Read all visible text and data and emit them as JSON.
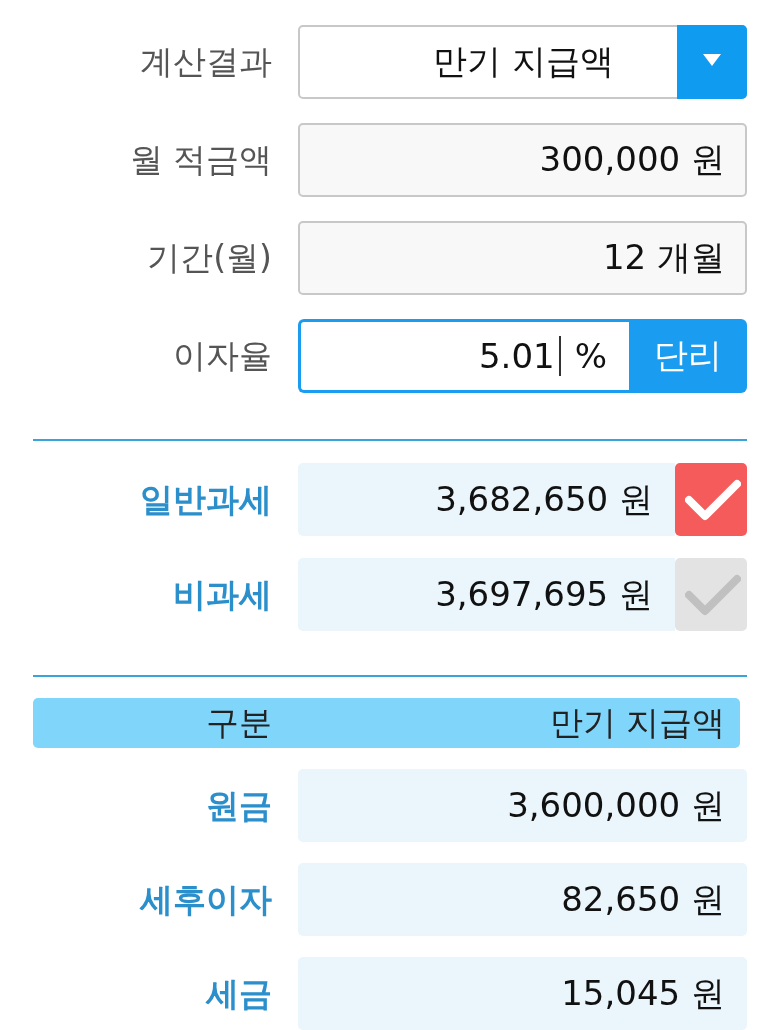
{
  "form_rows": [
    {
      "kind": "select",
      "label": "계산결과",
      "value": "만기 지급액"
    },
    {
      "kind": "text",
      "label": "월 적금액",
      "value": "300,000 원"
    },
    {
      "kind": "text",
      "label": "기간(월)",
      "value": "12 개월"
    },
    {
      "kind": "rate",
      "label": "이자율",
      "value": "5.01",
      "unit": "%",
      "focused": true,
      "button": "단리"
    }
  ],
  "tax_options": [
    {
      "label": "일반과세",
      "amount": "3,682,650 원",
      "checked": true
    },
    {
      "label": "비과세",
      "amount": "3,697,695 원",
      "checked": false
    }
  ],
  "breakdown": {
    "columns": [
      "구분",
      "만기 지급액"
    ],
    "rows": [
      {
        "label": "원금",
        "value": "3,600,000 원"
      },
      {
        "label": "세후이자",
        "value": "82,650 원"
      },
      {
        "label": "세금",
        "value": "15,045 원"
      }
    ]
  }
}
